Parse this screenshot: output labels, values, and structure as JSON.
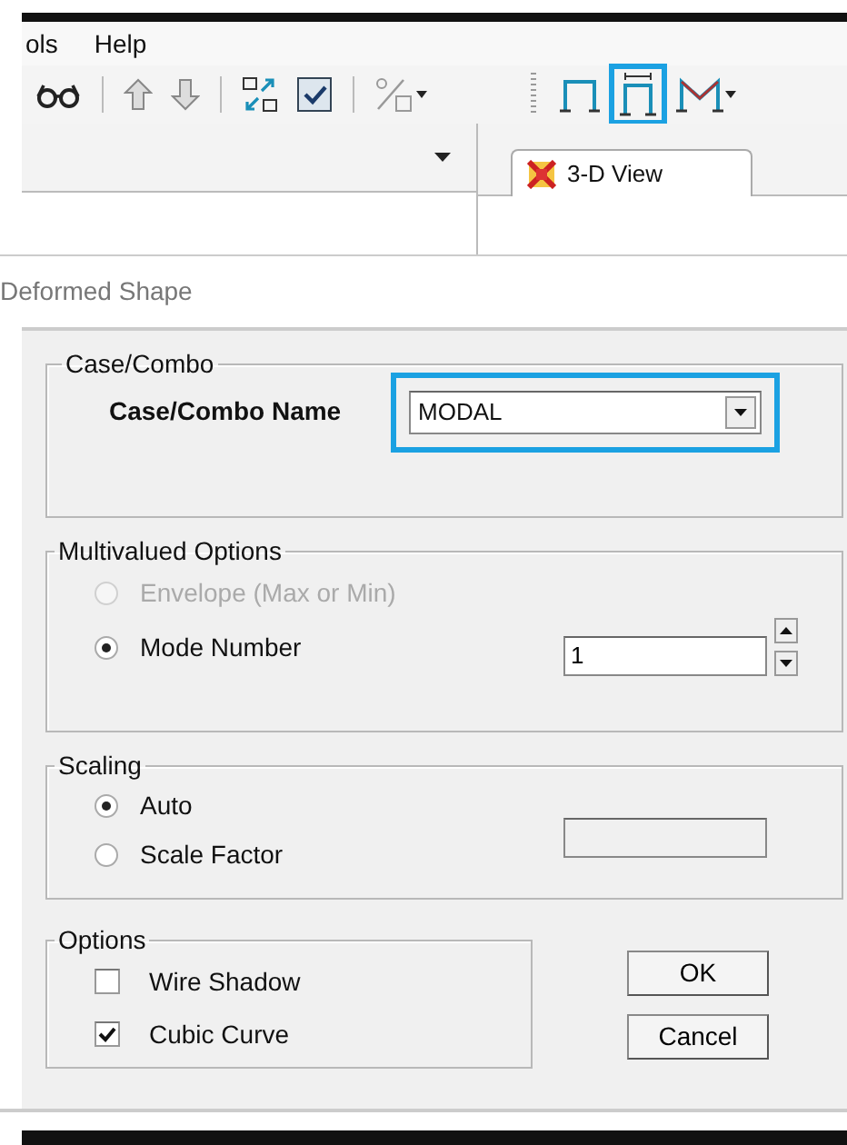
{
  "menu": [
    {
      "label": "ols"
    },
    {
      "label": "Help"
    }
  ],
  "toolbars": [
    {
      "groups": [
        {
          "items": [
            {
              "kind": "glasses",
              "highlighted": false
            }
          ]
        },
        {
          "items": [
            {
              "kind": "arrow-up",
              "highlighted": false
            },
            {
              "kind": "arrow-down",
              "highlighted": false
            }
          ]
        },
        {
          "items": [
            {
              "kind": "grid-arrows",
              "highlighted": false
            },
            {
              "kind": "checkbox",
              "highlighted": false
            }
          ]
        },
        {
          "items": [
            {
              "kind": "fraction",
              "highlighted": false
            }
          ]
        }
      ]
    },
    {
      "groups": [
        {
          "items": [
            {
              "kind": "frame",
              "highlighted": false
            },
            {
              "kind": "frame-braced",
              "highlighted": true
            },
            {
              "kind": "truss",
              "highlighted": false
            }
          ]
        }
      ]
    }
  ],
  "tab": {
    "label": "3-D View",
    "selected": true
  },
  "dialog": {
    "title": "Deformed Shape",
    "case_combo": {
      "legend": "Case/Combo",
      "label": "Case/Combo Name",
      "value": "MODAL",
      "highlighted": true
    },
    "multivalued": {
      "legend": "Multivalued Options",
      "options": [
        {
          "label": "Envelope (Max or Min)",
          "selected": false,
          "disabled": true
        },
        {
          "label": "Mode Number",
          "selected": true,
          "disabled": false
        }
      ],
      "mode_value": "1"
    },
    "scaling": {
      "legend": "Scaling",
      "options": [
        {
          "label": "Auto",
          "selected": true,
          "disabled": false
        },
        {
          "label": "Scale Factor",
          "selected": false,
          "disabled": false
        }
      ],
      "factor_disabled": true
    },
    "options": {
      "legend": "Options",
      "checks": [
        {
          "label": "Wire Shadow",
          "checked": false
        },
        {
          "label": "Cubic Curve",
          "checked": true
        }
      ]
    },
    "buttons": [
      {
        "label": "OK"
      },
      {
        "label": "Cancel"
      }
    ]
  }
}
